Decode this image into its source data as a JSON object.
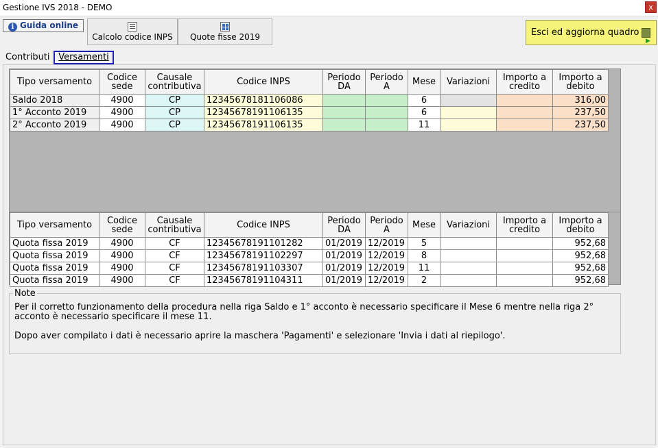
{
  "window": {
    "title": "Gestione IVS 2018 - DEMO",
    "close": "x"
  },
  "toolbar": {
    "guida": "Guida online",
    "calcolo": "Calcolo codice INPS",
    "quote": "Quote fisse 2019",
    "esci": "Esci ed aggiorna quadro"
  },
  "tabs": {
    "contributi": "Contributi",
    "versamenti": "Versamenti"
  },
  "headers": {
    "tipo": "Tipo versamento",
    "codice_sede": "Codice sede",
    "causale": "Causale contributiva",
    "codice_inps": "Codice INPS",
    "periodo_da": "Periodo DA",
    "periodo_a": "Periodo A",
    "mese": "Mese",
    "variazioni": "Variazioni",
    "credito": "Importo a credito",
    "debito": "Importo a debito"
  },
  "contributi_rows": [
    {
      "tipo": "Saldo 2018",
      "sede": "4900",
      "causale": "CP",
      "inps": "12345678181106086",
      "da": "",
      "a": "",
      "mese": "6",
      "variazioni": "",
      "credito": "",
      "debito": "316,00"
    },
    {
      "tipo": "1° Acconto 2019",
      "sede": "4900",
      "causale": "CP",
      "inps": "12345678191106135",
      "da": "",
      "a": "",
      "mese": "6",
      "variazioni": "",
      "credito": "",
      "debito": "237,50"
    },
    {
      "tipo": "2° Acconto 2019",
      "sede": "4900",
      "causale": "CP",
      "inps": "12345678191106135",
      "da": "",
      "a": "",
      "mese": "11",
      "variazioni": "",
      "credito": "",
      "debito": "237,50"
    }
  ],
  "quote_rows": [
    {
      "tipo": "Quota fissa 2019",
      "sede": "4900",
      "causale": "CF",
      "inps": "12345678191101282",
      "da": "01/2019",
      "a": "12/2019",
      "mese": "5",
      "variazioni": "",
      "credito": "",
      "debito": "952,68"
    },
    {
      "tipo": "Quota fissa 2019",
      "sede": "4900",
      "causale": "CF",
      "inps": "12345678191102297",
      "da": "01/2019",
      "a": "12/2019",
      "mese": "8",
      "variazioni": "",
      "credito": "",
      "debito": "952,68"
    },
    {
      "tipo": "Quota fissa 2019",
      "sede": "4900",
      "causale": "CF",
      "inps": "12345678191103307",
      "da": "01/2019",
      "a": "12/2019",
      "mese": "11",
      "variazioni": "",
      "credito": "",
      "debito": "952,68"
    },
    {
      "tipo": "Quota fissa 2019",
      "sede": "4900",
      "causale": "CF",
      "inps": "12345678191104311",
      "da": "01/2019",
      "a": "12/2019",
      "mese": "2",
      "variazioni": "",
      "credito": "",
      "debito": "952,68"
    }
  ],
  "note": {
    "legend": "Note",
    "line1": "Per il corretto funzionamento della procedura nella riga Saldo e 1° acconto è necessario specificare il Mese 6 mentre nella riga 2° acconto è necessario specificare il mese 11.",
    "line2": "Dopo aver compilato i dati è necessario aprire la maschera 'Pagamenti' e selezionare 'Invia i dati al riepilogo'."
  }
}
